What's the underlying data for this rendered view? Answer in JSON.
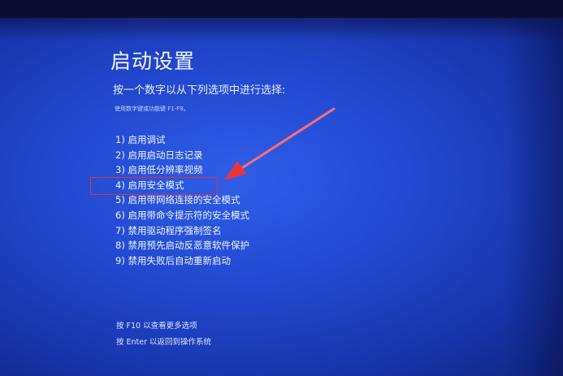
{
  "screen": {
    "title": "启动设置",
    "subtitle": "按一个数字以从下列选项中进行选择:",
    "hint": "使用数字键或功能键 F1-F9。",
    "options": [
      "1) 启用调试",
      "2) 启用启动日志记录",
      "3) 启用低分辨率视频",
      "4) 启用安全模式",
      "5) 启用带网络连接的安全模式",
      "6) 启用带命令提示符的安全模式",
      "7) 禁用驱动程序强制签名",
      "8) 禁用预先启动反恶意软件保护",
      "9) 禁用失败后自动重新启动"
    ],
    "footer": {
      "f10": "按 F10 以查看更多选项",
      "enter": "按 Enter 以返回到操作系统"
    }
  },
  "colors": {
    "background": "#2248d0",
    "annotation": "#e0333a",
    "text": "#ffffff"
  },
  "annotation": {
    "highlighted_option": "4) 启用安全模式",
    "arrow": "red-arrow-icon"
  }
}
